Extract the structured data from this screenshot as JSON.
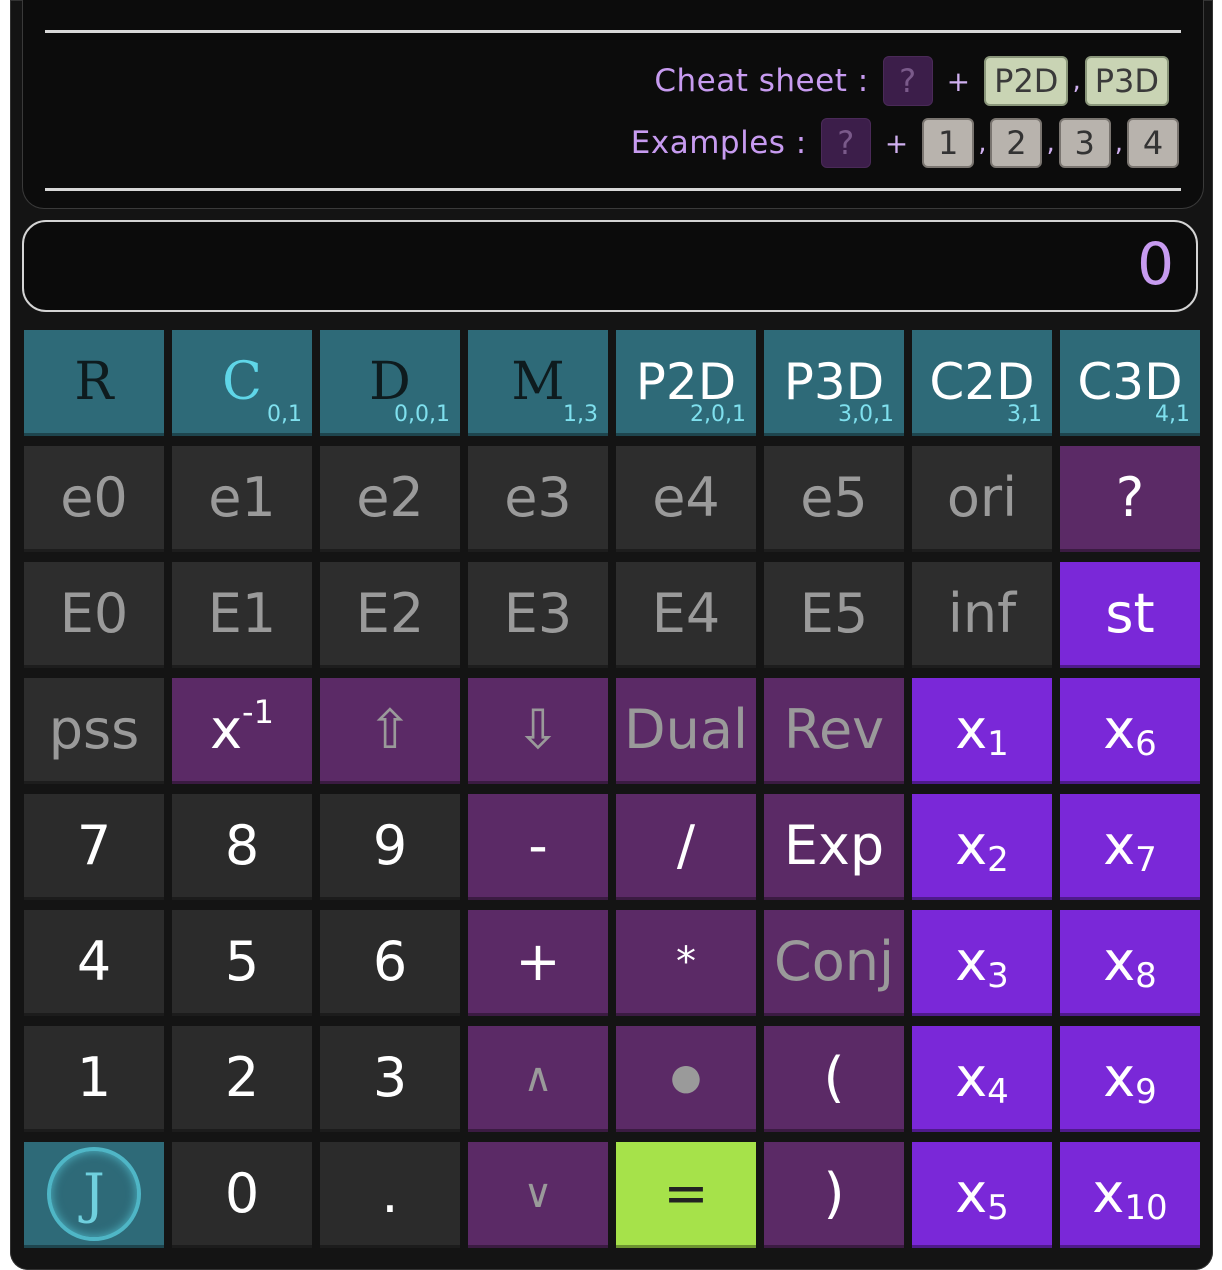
{
  "help": {
    "cheat_label": "Cheat sheet :",
    "cheat_q": "?",
    "plus": "+",
    "cheat_keys": [
      "P2D",
      "P3D"
    ],
    "comma": ",",
    "examples_label": "Examples :",
    "examples_q": "?",
    "example_keys": [
      "1",
      "2",
      "3",
      "4"
    ]
  },
  "display": {
    "value": "0"
  },
  "algebras": [
    {
      "label": "R",
      "sub": ""
    },
    {
      "label": "C",
      "sub": "0,1"
    },
    {
      "label": "D",
      "sub": "0,0,1"
    },
    {
      "label": "M",
      "sub": "1,3"
    },
    {
      "label": "P2D",
      "sub": "2,0,1"
    },
    {
      "label": "P3D",
      "sub": "3,0,1"
    },
    {
      "label": "C2D",
      "sub": "3,1"
    },
    {
      "label": "C3D",
      "sub": "4,1"
    }
  ],
  "row_basis": [
    "e0",
    "e1",
    "e2",
    "e3",
    "e4",
    "e5",
    "ori",
    "?"
  ],
  "row_dual": [
    "E0",
    "E1",
    "E2",
    "E3",
    "E4",
    "E5",
    "inf",
    "st"
  ],
  "row_ops": {
    "pss": "pss",
    "inverse_base": "x",
    "inverse_exp": "-1",
    "up": "⇧",
    "down": "⇩",
    "dual": "Dual",
    "rev": "Rev"
  },
  "digits": [
    "7",
    "8",
    "9",
    "4",
    "5",
    "6",
    "1",
    "2",
    "3",
    "0",
    "."
  ],
  "operators": {
    "minus": "-",
    "divide": "/",
    "exp": "Exp",
    "plus": "+",
    "times": "*",
    "conj": "Conj",
    "wedge": "∧",
    "dot": "●",
    "lparen": "(",
    "vee": "∨",
    "equals": "=",
    "rparen": ")"
  },
  "memories": [
    {
      "base": "x",
      "idx": "1"
    },
    {
      "base": "x",
      "idx": "2"
    },
    {
      "base": "x",
      "idx": "3"
    },
    {
      "base": "x",
      "idx": "4"
    },
    {
      "base": "x",
      "idx": "5"
    },
    {
      "base": "x",
      "idx": "6"
    },
    {
      "base": "x",
      "idx": "7"
    },
    {
      "base": "x",
      "idx": "8"
    },
    {
      "base": "x",
      "idx": "9"
    },
    {
      "base": "x",
      "idx": "10"
    }
  ],
  "logo_letter": "J",
  "colors": {
    "teal": "#2e6a78",
    "purple": "#5b2a66",
    "violet": "#7a28d8",
    "green": "#a6e24a",
    "accent_text": "#c79bf0"
  }
}
